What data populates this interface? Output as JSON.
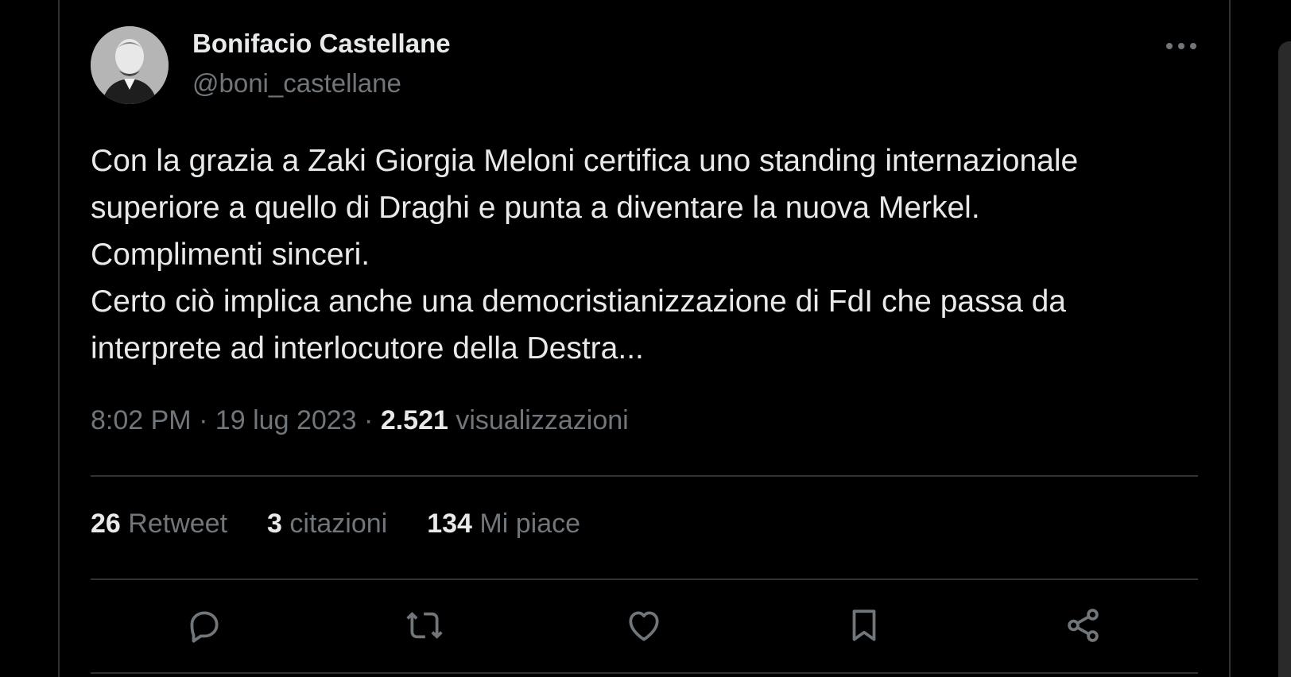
{
  "tweet": {
    "author": {
      "display_name": "Bonifacio Castellane",
      "handle": "@boni_castellane",
      "avatar_icon": "portrait-photo"
    },
    "text": "Con la grazia a Zaki Giorgia Meloni certifica uno standing internazionale\nsuperiore a quello di Draghi e punta a diventare la nuova Merkel.\nComplimenti sinceri.\nCerto ciò implica anche una democristianizzazione di FdI che passa da\ninterprete ad interlocutore della Destra...",
    "time": "8:02 PM",
    "separator": "·",
    "date": "19 lug 2023",
    "views_count": "2.521",
    "views_label": "visualizzazioni",
    "stats": {
      "retweets_count": "26",
      "retweets_label": "Retweet",
      "quotes_count": "3",
      "quotes_label": "citazioni",
      "likes_count": "134",
      "likes_label": "Mi piace"
    },
    "actions": {
      "reply_icon": "reply-icon",
      "retweet_icon": "retweet-icon",
      "like_icon": "heart-icon",
      "bookmark_icon": "bookmark-icon",
      "share_icon": "share-icon",
      "more_icon": "more-options-icon"
    }
  },
  "theme": {
    "background": "#000000",
    "text_primary": "#e7e9ea",
    "text_secondary": "#71767b",
    "divider": "#2f3336"
  }
}
